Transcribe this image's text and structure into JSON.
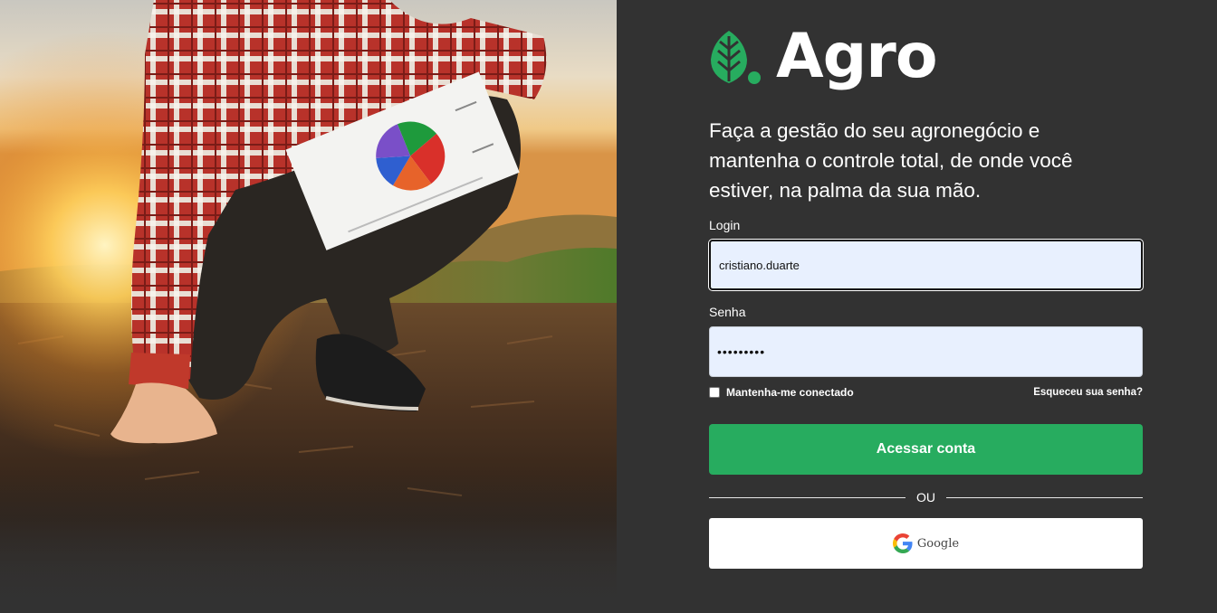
{
  "brand": {
    "name": "Agro",
    "accent_color": "#27ac5f",
    "logo_icon": "leaf-icon"
  },
  "hero": {
    "icon": "farmer-field-photo"
  },
  "tagline": "Faça a gestão do seu agronegócio e mantenha o controle total, de onde você estiver, na palma da sua mão.",
  "form": {
    "login_label": "Login",
    "login_value": "cristiano.duarte",
    "password_label": "Senha",
    "password_value": "•••••••••",
    "remember_label": "Mantenha-me conectado",
    "remember_checked": false,
    "forgot_label": "Esqueceu sua senha?",
    "submit_label": "Acessar conta",
    "divider_label": "OU",
    "google_label": "Google",
    "google_icon": "google-g-icon"
  },
  "colors": {
    "panel_bg": "#323232",
    "input_bg": "#e8f0fe",
    "button_green": "#27ac5f"
  }
}
